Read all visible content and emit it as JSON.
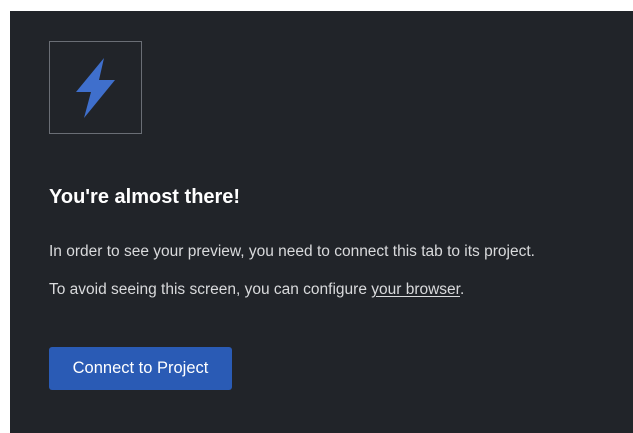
{
  "logo": {
    "icon": "lightning-bolt-icon",
    "color": "#3f6fcc"
  },
  "heading": "You're almost there!",
  "message": {
    "line1": "In order to see your preview, you need to connect this tab to its project.",
    "line2_prefix": "To avoid seeing this screen, you can configure ",
    "line2_link": "your browser",
    "line2_suffix": "."
  },
  "connect_button": {
    "label": "Connect to Project",
    "color": "#2a5bb5"
  },
  "colors": {
    "background": "#212429",
    "text": "#d9dadc"
  }
}
